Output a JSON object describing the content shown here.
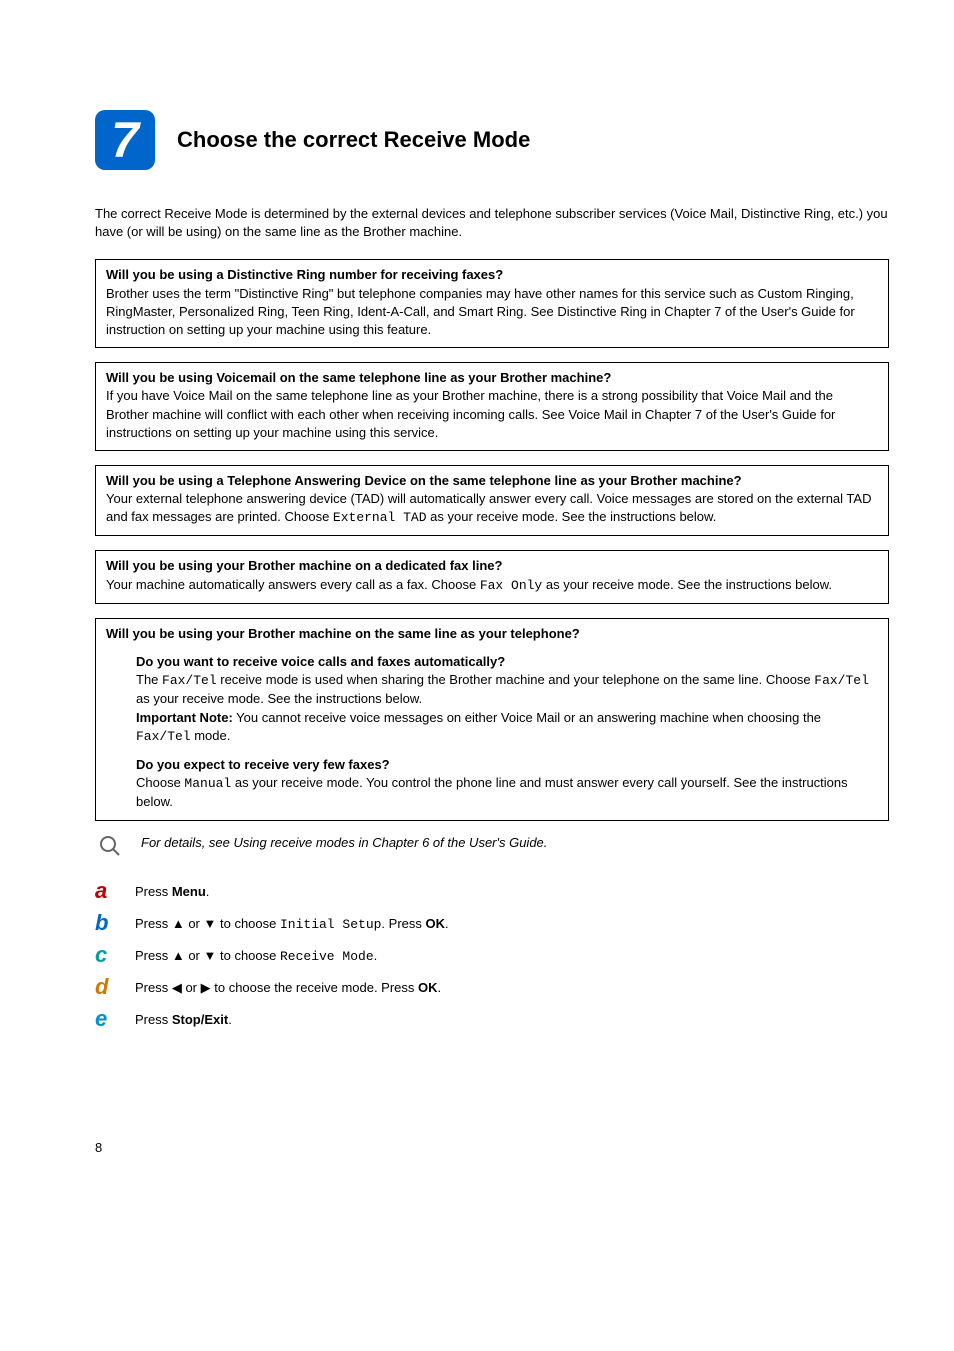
{
  "header": {
    "step_number": "7",
    "title": "Choose the correct Receive Mode"
  },
  "intro": "The correct Receive Mode is determined by the external devices and telephone subscriber services (Voice Mail, Distinctive Ring, etc.) you have (or will be using) on the same line as the Brother machine.",
  "box1": {
    "title": "Will you be using a Distinctive Ring number for receiving faxes?",
    "body": "Brother uses the term \"Distinctive Ring\" but telephone companies may have other names for this service such as Custom Ringing, RingMaster, Personalized Ring, Teen Ring, Ident-A-Call, and Smart Ring. See Distinctive Ring in Chapter 7 of the User's Guide for instruction on setting up your machine using this feature."
  },
  "box2": {
    "title": "Will you be using Voicemail on the same telephone line as your Brother machine?",
    "body": "If you have Voice Mail on the same telephone line as your Brother machine, there is a strong possibility that Voice Mail and the Brother machine will conflict with each other when receiving incoming calls. See Voice Mail in Chapter 7 of the User's Guide for instructions on setting up your machine using this service."
  },
  "box3": {
    "title": "Will you be using a Telephone Answering Device on the same telephone line as your Brother machine?",
    "body_pre": "Your external telephone answering device (TAD) will automatically answer every call. Voice messages are stored on the external TAD and fax messages are printed. Choose ",
    "mono": "External TAD",
    "body_post": " as your receive mode. See the instructions below."
  },
  "box4": {
    "title": "Will you be using your Brother machine on a dedicated fax line?",
    "body_pre": "Your machine automatically answers every call as a fax. Choose ",
    "mono": "Fax Only",
    "body_post": " as your receive mode. See the instructions below."
  },
  "box5": {
    "title": "Will you be using your Brother machine on the same line as your telephone?",
    "sub1_title": "Do you want to receive voice calls and faxes automatically?",
    "sub1_l1a": "The ",
    "sub1_l1_mono1": "Fax/Tel",
    "sub1_l1b": " receive mode is used when sharing the Brother machine and your telephone on the same line. Choose ",
    "sub1_l1_mono2": "Fax/Tel",
    "sub1_l1c": " as your receive mode. See the instructions below.",
    "sub1_imp_label": "Important Note:",
    "sub1_imp_a": " You cannot receive voice messages on either Voice Mail or an answering machine when choosing the ",
    "sub1_imp_mono": "Fax/Tel",
    "sub1_imp_b": " mode.",
    "sub2_title": "Do you expect to receive very few faxes?",
    "sub2_a": "Choose ",
    "sub2_mono": "Manual",
    "sub2_b": " as your receive mode. You control the phone line and must answer every call yourself. See the instructions below."
  },
  "hint": "For details, see Using receive modes in Chapter 6 of the User's Guide.",
  "steps": {
    "a_pre": "Press ",
    "a_bold": "Menu",
    "a_post": ".",
    "b_pre": "Press ",
    "b_arrow1": "a",
    "b_mid1": " or ",
    "b_arrow2": "b",
    "b_mid2": " to choose ",
    "b_mono": "Initial Setup",
    "b_post": ". Press ",
    "b_bold": "OK",
    "b_end": ".",
    "c_pre": "Press ",
    "c_arrow1": "a",
    "c_mid1": " or ",
    "c_arrow2": "b",
    "c_mid2": " to choose ",
    "c_mono": "Receive Mode",
    "c_post": ".",
    "d_pre": "Press ",
    "d_arrow1": "d",
    "d_mid1": " or ",
    "d_arrow2": "c",
    "d_mid2": " to choose the receive mode. Press ",
    "d_bold": "OK",
    "d_post": ".",
    "e_pre": "Press ",
    "e_bold": "Stop/Exit",
    "e_post": "."
  },
  "page_number": "8",
  "letters": {
    "a": "a",
    "b": "b",
    "c": "c",
    "d": "d",
    "e": "e"
  },
  "arrows": {
    "up": "▲",
    "down": "▼",
    "left": "◀",
    "right": "▶"
  }
}
